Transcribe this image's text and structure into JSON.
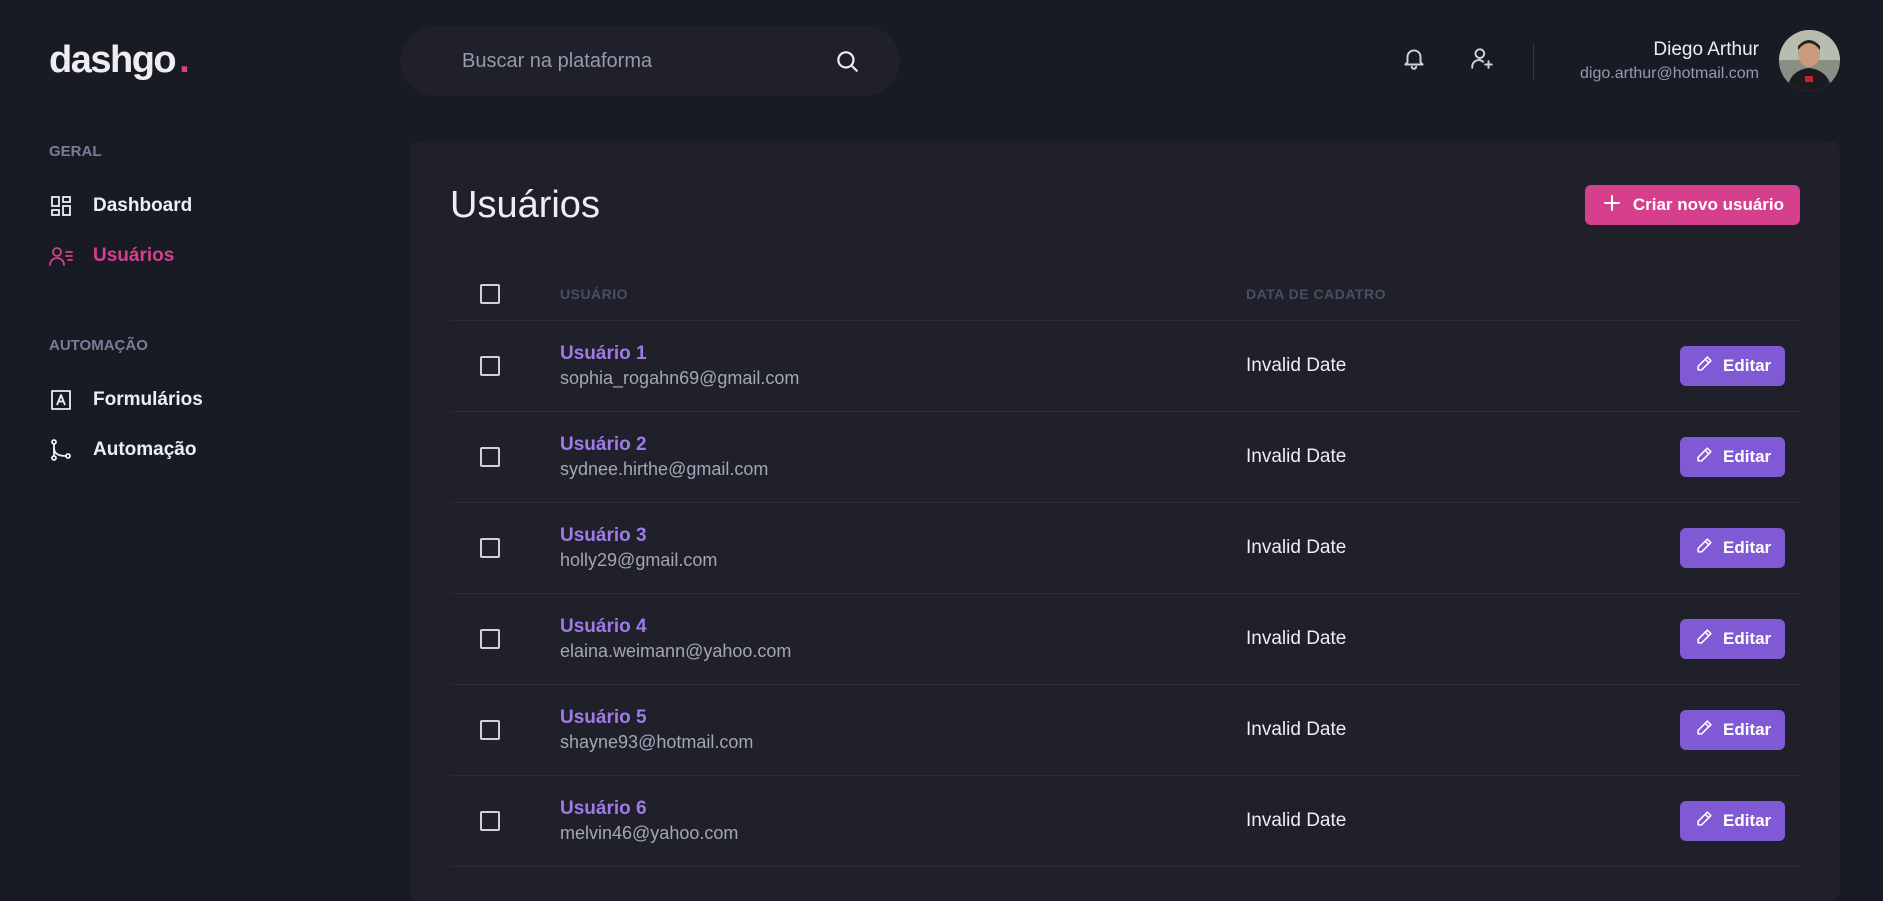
{
  "brand": {
    "name": "dashgo",
    "dot": ".",
    "accent_color": "#d53f8c"
  },
  "search": {
    "placeholder": "Buscar na plataforma",
    "value": "",
    "icon": "search-icon"
  },
  "header_icons": [
    "bell-icon",
    "user-plus-icon"
  ],
  "profile": {
    "name": "Diego Arthur",
    "email": "digo.arthur@hotmail.com"
  },
  "sidebar": {
    "sections": [
      {
        "title": "GERAL",
        "items": [
          {
            "label": "Dashboard",
            "icon": "dashboard-icon",
            "active": false
          },
          {
            "label": "Usuários",
            "icon": "users-icon",
            "active": true
          }
        ]
      },
      {
        "title": "AUTOMAÇÃO",
        "items": [
          {
            "label": "Formulários",
            "icon": "form-icon",
            "active": false
          },
          {
            "label": "Automação",
            "icon": "git-merge-icon",
            "active": false
          }
        ]
      }
    ]
  },
  "main": {
    "title": "Usuários",
    "create_label": "Criar novo usuário",
    "columns": {
      "user": "USUÁRIO",
      "date": "DATA DE CADATRO"
    },
    "edit_label": "Editar",
    "users": [
      {
        "name": "Usuário 1",
        "email": "sophia_rogahn69@gmail.com",
        "date": "Invalid Date"
      },
      {
        "name": "Usuário 2",
        "email": "sydnee.hirthe@gmail.com",
        "date": "Invalid Date"
      },
      {
        "name": "Usuário 3",
        "email": "holly29@gmail.com",
        "date": "Invalid Date"
      },
      {
        "name": "Usuário 4",
        "email": "elaina.weimann@yahoo.com",
        "date": "Invalid Date"
      },
      {
        "name": "Usuário 5",
        "email": "shayne93@hotmail.com",
        "date": "Invalid Date"
      },
      {
        "name": "Usuário 6",
        "email": "melvin46@yahoo.com",
        "date": "Invalid Date"
      }
    ]
  },
  "colors": {
    "background": "#181b23",
    "surface": "#1f2029",
    "pink": "#d53f8c",
    "purple": "#805ad5",
    "user_name": "#9f7aea"
  }
}
